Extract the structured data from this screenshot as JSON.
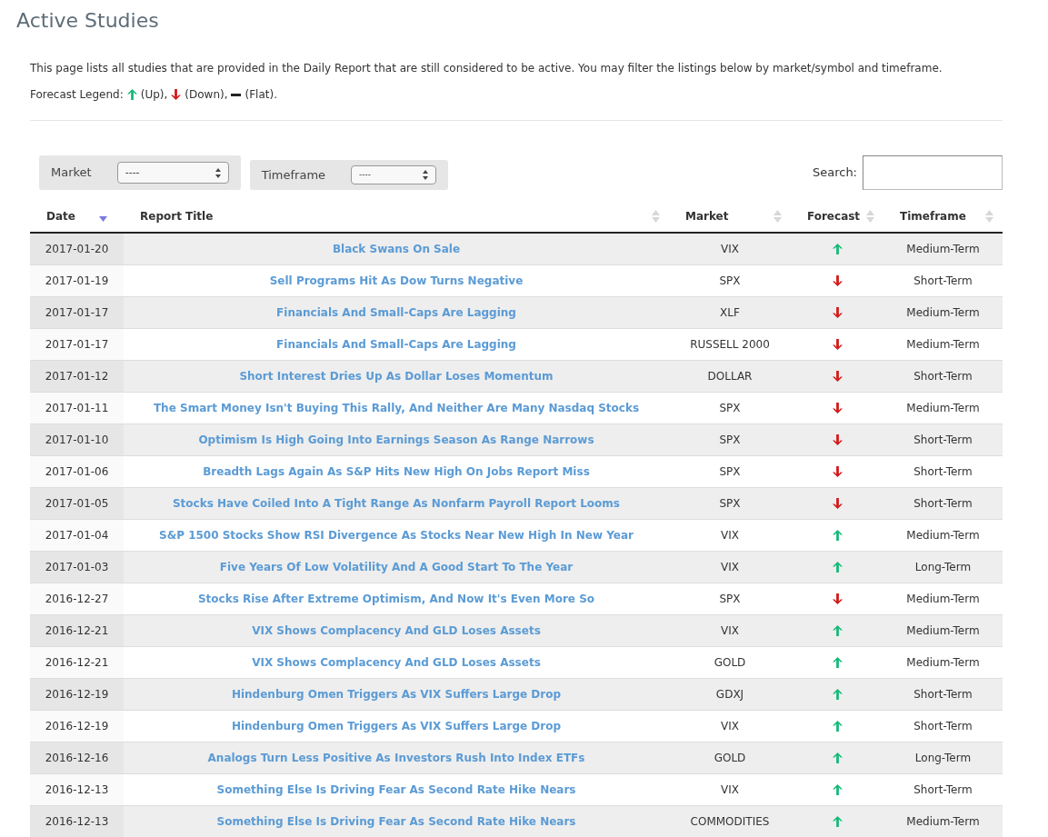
{
  "title": "Active Studies",
  "intro": "This page lists all studies that are provided in the Daily Report that are still considered to be active. You may filter the listings below by market/symbol and timeframe.",
  "legend": {
    "label": "Forecast Legend:",
    "items": [
      {
        "kind": "up",
        "text": "(Up),"
      },
      {
        "kind": "down",
        "text": "(Down),"
      },
      {
        "kind": "flat",
        "text": "(Flat)."
      }
    ]
  },
  "filters": [
    {
      "label": "Market",
      "value": "----"
    },
    {
      "label": "Timeframe",
      "value": "----"
    }
  ],
  "search": {
    "label": "Search:"
  },
  "table": {
    "columns": [
      {
        "label": "Date",
        "kind": "desc"
      },
      {
        "label": "Report Title",
        "kind": "none"
      },
      {
        "label": "Market",
        "kind": "none"
      },
      {
        "label": "Forecast",
        "kind": "none"
      },
      {
        "label": "Timeframe",
        "kind": "none"
      }
    ],
    "rows": [
      {
        "date": "2017-01-20",
        "title": "Black Swans On Sale",
        "market": "VIX",
        "forecast": {
          "kind": "up"
        },
        "timeframe": "Medium-Term"
      },
      {
        "date": "2017-01-19",
        "title": "Sell Programs Hit As Dow Turns Negative",
        "market": "SPX",
        "forecast": {
          "kind": "down"
        },
        "timeframe": "Short-Term"
      },
      {
        "date": "2017-01-17",
        "title": "Financials And Small-Caps Are Lagging",
        "market": "XLF",
        "forecast": {
          "kind": "down"
        },
        "timeframe": "Medium-Term"
      },
      {
        "date": "2017-01-17",
        "title": "Financials And Small-Caps Are Lagging",
        "market": "RUSSELL 2000",
        "forecast": {
          "kind": "down"
        },
        "timeframe": "Medium-Term"
      },
      {
        "date": "2017-01-12",
        "title": "Short Interest Dries Up As Dollar Loses Momentum",
        "market": "DOLLAR",
        "forecast": {
          "kind": "down"
        },
        "timeframe": "Short-Term"
      },
      {
        "date": "2017-01-11",
        "title": "The Smart Money Isn't Buying This Rally, And Neither Are Many Nasdaq Stocks",
        "market": "SPX",
        "forecast": {
          "kind": "down"
        },
        "timeframe": "Medium-Term"
      },
      {
        "date": "2017-01-10",
        "title": "Optimism Is High Going Into Earnings Season As Range Narrows",
        "market": "SPX",
        "forecast": {
          "kind": "down"
        },
        "timeframe": "Short-Term"
      },
      {
        "date": "2017-01-06",
        "title": "Breadth Lags Again As S&P Hits New High On Jobs Report Miss",
        "market": "SPX",
        "forecast": {
          "kind": "down"
        },
        "timeframe": "Short-Term"
      },
      {
        "date": "2017-01-05",
        "title": "Stocks Have Coiled Into A Tight Range As Nonfarm Payroll Report Looms",
        "market": "SPX",
        "forecast": {
          "kind": "down"
        },
        "timeframe": "Short-Term"
      },
      {
        "date": "2017-01-04",
        "title": "S&P 1500 Stocks Show RSI Divergence As Stocks Near New High In New Year",
        "market": "VIX",
        "forecast": {
          "kind": "up"
        },
        "timeframe": "Medium-Term"
      },
      {
        "date": "2017-01-03",
        "title": "Five Years Of Low Volatility And A Good Start To The Year",
        "market": "VIX",
        "forecast": {
          "kind": "up"
        },
        "timeframe": "Long-Term"
      },
      {
        "date": "2016-12-27",
        "title": "Stocks Rise After Extreme Optimism, And Now It's Even More So",
        "market": "SPX",
        "forecast": {
          "kind": "down"
        },
        "timeframe": "Medium-Term"
      },
      {
        "date": "2016-12-21",
        "title": "VIX Shows Complacency And GLD Loses Assets",
        "market": "VIX",
        "forecast": {
          "kind": "up"
        },
        "timeframe": "Medium-Term"
      },
      {
        "date": "2016-12-21",
        "title": "VIX Shows Complacency And GLD Loses Assets",
        "market": "GOLD",
        "forecast": {
          "kind": "up"
        },
        "timeframe": "Medium-Term"
      },
      {
        "date": "2016-12-19",
        "title": "Hindenburg Omen Triggers As VIX Suffers Large Drop",
        "market": "GDXJ",
        "forecast": {
          "kind": "up"
        },
        "timeframe": "Short-Term"
      },
      {
        "date": "2016-12-19",
        "title": "Hindenburg Omen Triggers As VIX Suffers Large Drop",
        "market": "VIX",
        "forecast": {
          "kind": "up"
        },
        "timeframe": "Short-Term"
      },
      {
        "date": "2016-12-16",
        "title": "Analogs Turn Less Positive As Investors Rush Into Index ETFs",
        "market": "GOLD",
        "forecast": {
          "kind": "up"
        },
        "timeframe": "Long-Term"
      },
      {
        "date": "2016-12-13",
        "title": "Something Else Is Driving Fear As Second Rate Hike Nears",
        "market": "VIX",
        "forecast": {
          "kind": "up"
        },
        "timeframe": "Short-Term"
      },
      {
        "date": "2016-12-13",
        "title": "Something Else Is Driving Fear As Second Rate Hike Nears",
        "market": "COMMODITIES",
        "forecast": {
          "kind": "up"
        },
        "timeframe": "Medium-Term"
      }
    ]
  }
}
